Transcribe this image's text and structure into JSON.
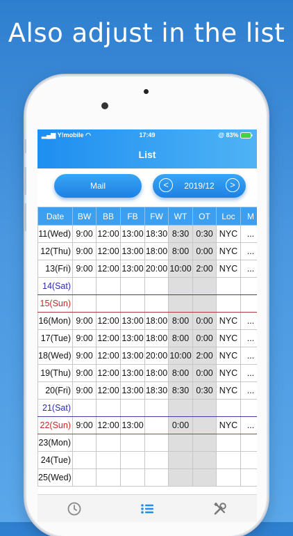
{
  "headline": "Also adjust in the list",
  "status": {
    "carrier": "Y!mobile",
    "time": "17:49",
    "battery": "@ 83%"
  },
  "nav": {
    "title": "List"
  },
  "toolbar": {
    "mail_label": "Mail",
    "month": "2019/12"
  },
  "table": {
    "headers": [
      "Date",
      "BW",
      "BB",
      "FB",
      "FW",
      "WT",
      "OT",
      "Loc",
      "M"
    ],
    "rows": [
      {
        "date": "11(Wed)",
        "BW": "9:00",
        "BB": "12:00",
        "FB": "13:00",
        "FW": "18:30",
        "WT": "8:30",
        "OT": "0:30",
        "Loc": "NYC",
        "M": "..."
      },
      {
        "date": "12(Thu)",
        "BW": "9:00",
        "BB": "12:00",
        "FB": "13:00",
        "FW": "18:00",
        "WT": "8:00",
        "OT": "0:00",
        "Loc": "NYC",
        "M": "..."
      },
      {
        "date": "13(Fri)",
        "BW": "9:00",
        "BB": "12:00",
        "FB": "13:00",
        "FW": "20:00",
        "WT": "10:00",
        "OT": "2:00",
        "Loc": "NYC",
        "M": "..."
      },
      {
        "date": "14(Sat)",
        "BW": "",
        "BB": "",
        "FB": "",
        "FW": "",
        "WT": "",
        "OT": "",
        "Loc": "",
        "M": ""
      },
      {
        "date": "15(Sun)",
        "BW": "",
        "BB": "",
        "FB": "",
        "FW": "",
        "WT": "",
        "OT": "",
        "Loc": "",
        "M": ""
      },
      {
        "date": "16(Mon)",
        "BW": "9:00",
        "BB": "12:00",
        "FB": "13:00",
        "FW": "18:00",
        "WT": "8:00",
        "OT": "0:00",
        "Loc": "NYC",
        "M": "..."
      },
      {
        "date": "17(Tue)",
        "BW": "9:00",
        "BB": "12:00",
        "FB": "13:00",
        "FW": "18:00",
        "WT": "8:00",
        "OT": "0:00",
        "Loc": "NYC",
        "M": "..."
      },
      {
        "date": "18(Wed)",
        "BW": "9:00",
        "BB": "12:00",
        "FB": "13:00",
        "FW": "20:00",
        "WT": "10:00",
        "OT": "2:00",
        "Loc": "NYC",
        "M": "..."
      },
      {
        "date": "19(Thu)",
        "BW": "9:00",
        "BB": "12:00",
        "FB": "13:00",
        "FW": "18:00",
        "WT": "8:00",
        "OT": "0:00",
        "Loc": "NYC",
        "M": "..."
      },
      {
        "date": "20(Fri)",
        "BW": "9:00",
        "BB": "12:00",
        "FB": "13:00",
        "FW": "18:30",
        "WT": "8:30",
        "OT": "0:30",
        "Loc": "NYC",
        "M": "..."
      },
      {
        "date": "21(Sat)",
        "BW": "",
        "BB": "",
        "FB": "",
        "FW": "",
        "WT": "",
        "OT": "",
        "Loc": "",
        "M": ""
      },
      {
        "date": "22(Sun)",
        "BW": "9:00",
        "BB": "12:00",
        "FB": "13:00",
        "FW": "",
        "WT": "0:00",
        "OT": "",
        "Loc": "NYC",
        "M": "..."
      },
      {
        "date": "23(Mon)",
        "BW": "",
        "BB": "",
        "FB": "",
        "FW": "",
        "WT": "",
        "OT": "",
        "Loc": "",
        "M": ""
      },
      {
        "date": "24(Tue)",
        "BW": "",
        "BB": "",
        "FB": "",
        "FW": "",
        "WT": "",
        "OT": "",
        "Loc": "",
        "M": ""
      },
      {
        "date": "25(Wed)",
        "BW": "",
        "BB": "",
        "FB": "",
        "FW": "",
        "WT": "",
        "OT": "",
        "Loc": "",
        "M": ""
      }
    ]
  },
  "tabbar": {
    "icons": [
      "clock-icon",
      "list-icon",
      "tools-icon"
    ]
  },
  "colors": {
    "accent": "#1e8ef0",
    "saturday": "#2a2ab0",
    "sunday": "#c42828"
  }
}
